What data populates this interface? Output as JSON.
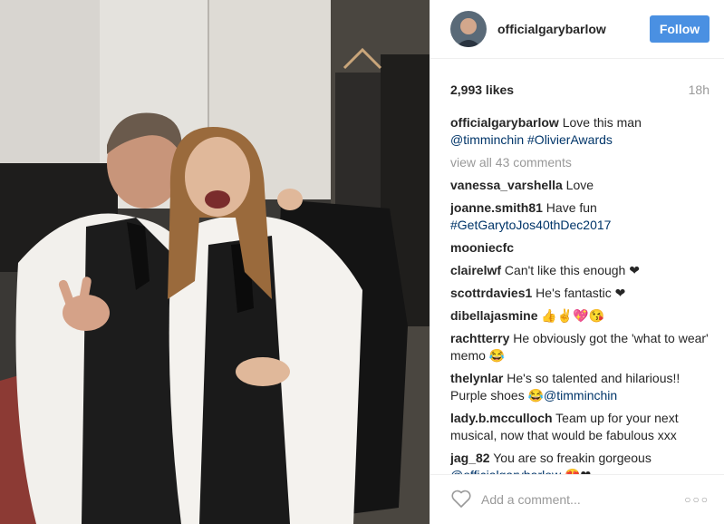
{
  "post": {
    "username": "officialgarybarlow",
    "follow_label": "Follow",
    "likes": "2,993 likes",
    "time": "18h",
    "view_all": "view all 43 comments",
    "caption": {
      "user": "officialgarybarlow",
      "text": " Love this man ",
      "mention": "@timminchin",
      "hashtag": " #OlivierAwards"
    },
    "comments": [
      {
        "user": "vanessa_varshella",
        "text": " Love"
      },
      {
        "user": "joanne.smith81",
        "text": " Have fun ",
        "tag": "#GetGarytoJos40thDec2017"
      },
      {
        "user": "mooniecfc",
        "text": ""
      },
      {
        "user": "clairelwf",
        "text": " Can't like this enough ❤"
      },
      {
        "user": "scottrdavies1",
        "text": " He's fantastic ❤"
      },
      {
        "user": "dibellajasmine",
        "text": " 👍✌💖😘"
      },
      {
        "user": "rachtterry",
        "text": " He obviously got the 'what to wear' memo 😂"
      },
      {
        "user": "thelynlar",
        "text": " He's so talented and hilarious!! Purple shoes 😂",
        "tag": "@timminchin"
      },
      {
        "user": "lady.b.mcculloch",
        "text": " Team up for your next musical, now that would be fabulous xxx"
      },
      {
        "user": "jag_82",
        "text": " You are so freakin gorgeous ",
        "tag": "@officialgarybarlow",
        "tail": " 😍❤"
      }
    ],
    "add_comment_placeholder": "Add a comment...",
    "more_dots": "○○○"
  },
  "colors": {
    "follow": "#4a90e2",
    "link": "#003569"
  }
}
